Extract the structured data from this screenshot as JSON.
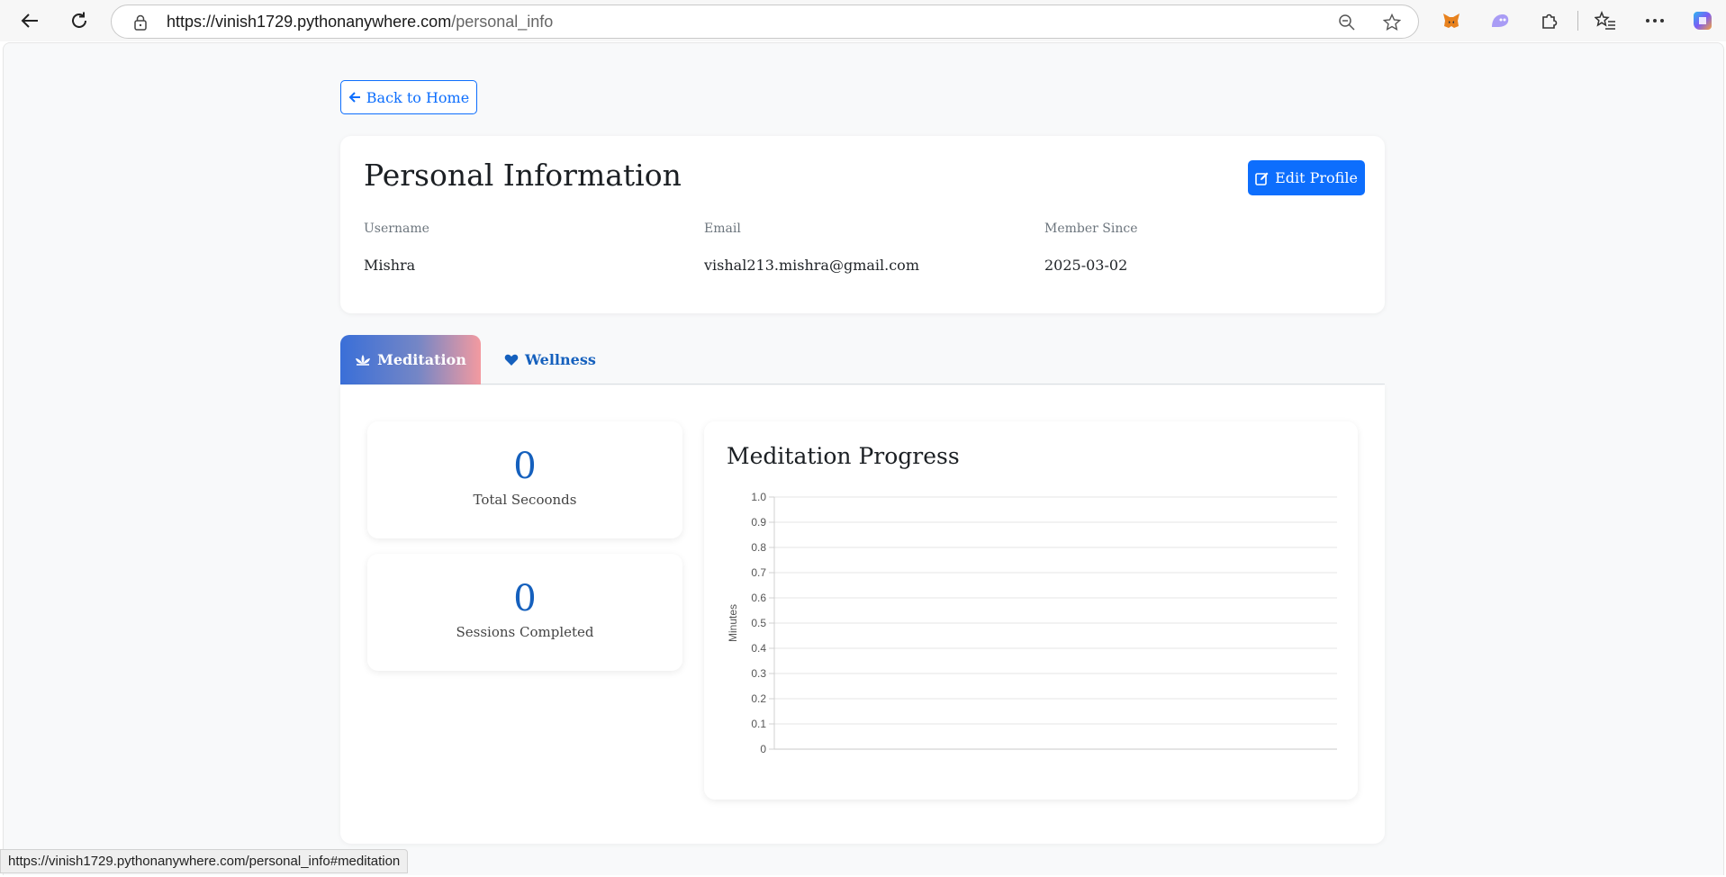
{
  "browser": {
    "url_host": "https://vinish1729.pythonanywhere.com",
    "url_path": "/personal_info"
  },
  "page": {
    "back_label": "Back to Home",
    "title": "Personal Information",
    "edit_label": "Edit Profile",
    "fields": [
      {
        "label": "Username",
        "value": "Mishra"
      },
      {
        "label": "Email",
        "value": "vishal213.mishra@gmail.com"
      },
      {
        "label": "Member Since",
        "value": "2025-03-02"
      }
    ],
    "tabs": [
      {
        "label": "Meditation",
        "active": true
      },
      {
        "label": "Wellness",
        "active": false
      }
    ],
    "stats": [
      {
        "value": "0",
        "label": "Total Secoonds"
      },
      {
        "value": "0",
        "label": "Sessions Completed"
      }
    ]
  },
  "chart_data": {
    "type": "line",
    "title": "Meditation Progress",
    "xlabel": "",
    "ylabel": "Minutes",
    "ylim": [
      0,
      1
    ],
    "yticks": [
      "1.0",
      "0.9",
      "0.8",
      "0.7",
      "0.6",
      "0.5",
      "0.4",
      "0.3",
      "0.2",
      "0.1",
      "0"
    ],
    "categories": [],
    "series": [],
    "grid": true
  },
  "status_bar": {
    "text": "https://vinish1729.pythonanywhere.com/personal_info#meditation"
  },
  "colors": {
    "primary": "#0d6efd",
    "stat_number": "#1560bd",
    "tab_gradient_start": "#3a6fd8",
    "tab_gradient_end": "#f39aa0"
  }
}
